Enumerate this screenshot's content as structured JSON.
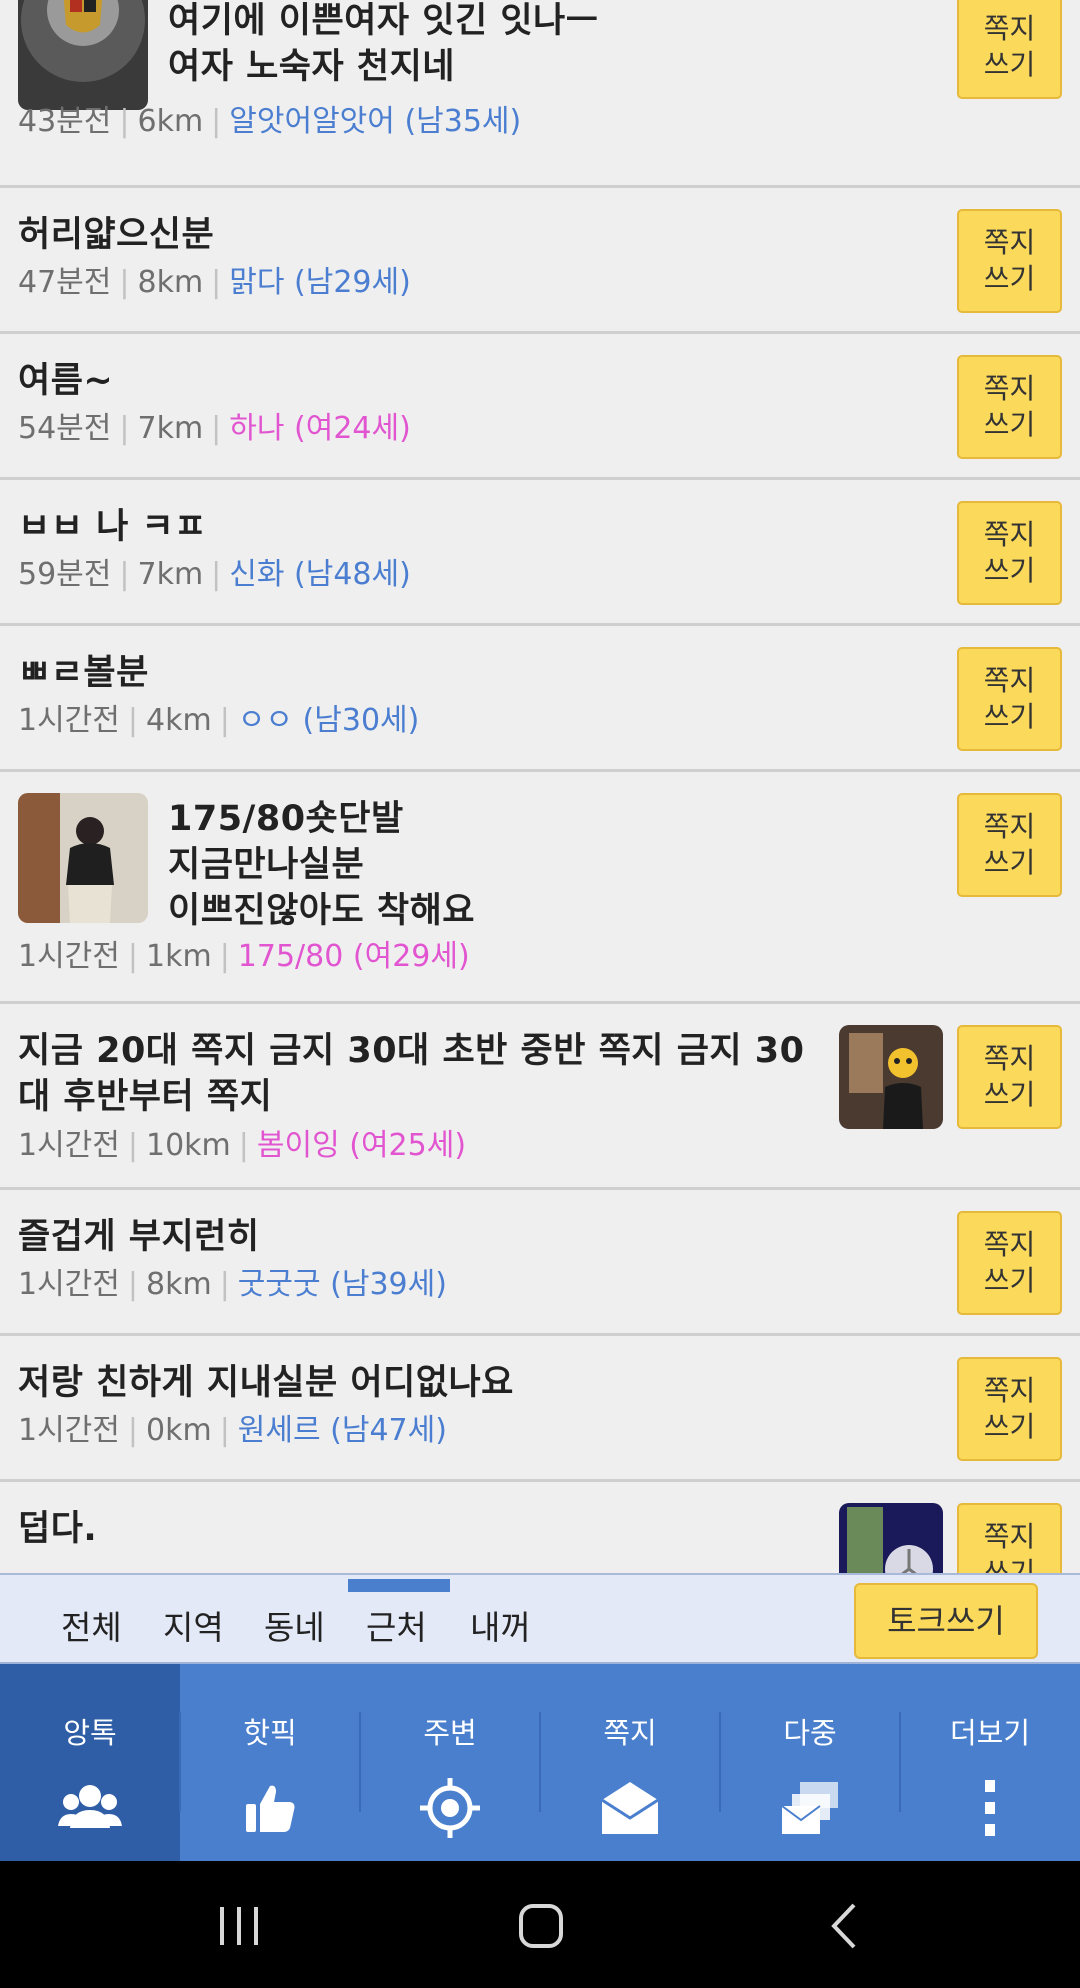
{
  "posts": [
    {
      "title": "여기에 이쁜여자 잇긴 잇나ㅡ\n여자 노숙자 천지네",
      "time": "43분전",
      "distance": "6km",
      "nickname": "알앗어알앗어",
      "gender_age": "(남35세)",
      "gender": "male",
      "has_avatar": true,
      "has_thumb": false,
      "button": [
        "쪽지",
        "쓰기"
      ]
    },
    {
      "title": "허리얇으신분",
      "time": "47분전",
      "distance": "8km",
      "nickname": "맑다",
      "gender_age": "(남29세)",
      "gender": "male",
      "button": [
        "쪽지",
        "쓰기"
      ]
    },
    {
      "title": "여름~",
      "time": "54분전",
      "distance": "7km",
      "nickname": "하나",
      "gender_age": "(여24세)",
      "gender": "female",
      "button": [
        "쪽지",
        "쓰기"
      ]
    },
    {
      "title": "ㅂㅂ 나 ㅋㅍ",
      "time": "59분전",
      "distance": "7km",
      "nickname": "신화",
      "gender_age": "(남48세)",
      "gender": "male",
      "button": [
        "쪽지",
        "쓰기"
      ]
    },
    {
      "title": "ㅃㄹ볼분",
      "time": "1시간전",
      "distance": "4km",
      "nickname": "ㅇㅇ",
      "gender_age": "(남30세)",
      "gender": "male",
      "button": [
        "쪽지",
        "쓰기"
      ]
    },
    {
      "title": "175/80숏단발\n지금만나실분\n이쁘진않아도 착해요",
      "time": "1시간전",
      "distance": "1km",
      "nickname": "175/80",
      "gender_age": "(여29세)",
      "gender": "female",
      "button": [
        "쪽지",
        "쓰기"
      ]
    },
    {
      "title": "지금 20대 쪽지 금지 30대 초반 중반 쪽지 금지 30\n대 후반부터 쪽지",
      "time": "1시간전",
      "distance": "10km",
      "nickname": "봄이잉",
      "gender_age": "(여25세)",
      "gender": "female",
      "button": [
        "쪽지",
        "쓰기"
      ]
    },
    {
      "title": "즐겁게 부지런히",
      "time": "1시간전",
      "distance": "8km",
      "nickname": "굿굿굿",
      "gender_age": "(남39세)",
      "gender": "male",
      "button": [
        "쪽지",
        "쓰기"
      ]
    },
    {
      "title": "저랑 친하게 지내실분 어디없나요",
      "time": "1시간전",
      "distance": "0km",
      "nickname": "원세르",
      "gender_age": "(남47세)",
      "gender": "male",
      "button": [
        "쪽지",
        "쓰기"
      ]
    },
    {
      "title": "덥다.",
      "button": [
        "쪽지",
        "쓰기"
      ]
    }
  ],
  "filter_tabs": [
    "전체",
    "지역",
    "동네",
    "근처",
    "내꺼"
  ],
  "filter_active": "근처",
  "talk_button": "토크쓰기",
  "nav": [
    {
      "label": "앙톡",
      "icon": "people-icon",
      "active": true
    },
    {
      "label": "핫픽",
      "icon": "thumbs-up-icon"
    },
    {
      "label": "주변",
      "icon": "location-target-icon"
    },
    {
      "label": "쪽지",
      "icon": "envelope-icon"
    },
    {
      "label": "다중",
      "icon": "multi-message-icon"
    },
    {
      "label": "더보기",
      "icon": "more-vertical-icon"
    }
  ],
  "colors": {
    "accent": "#4a7fce",
    "accent_dark": "#2f5ea7",
    "button_yellow": "#fbd95a",
    "male": "#4b7ed0",
    "female": "#e255d0"
  }
}
